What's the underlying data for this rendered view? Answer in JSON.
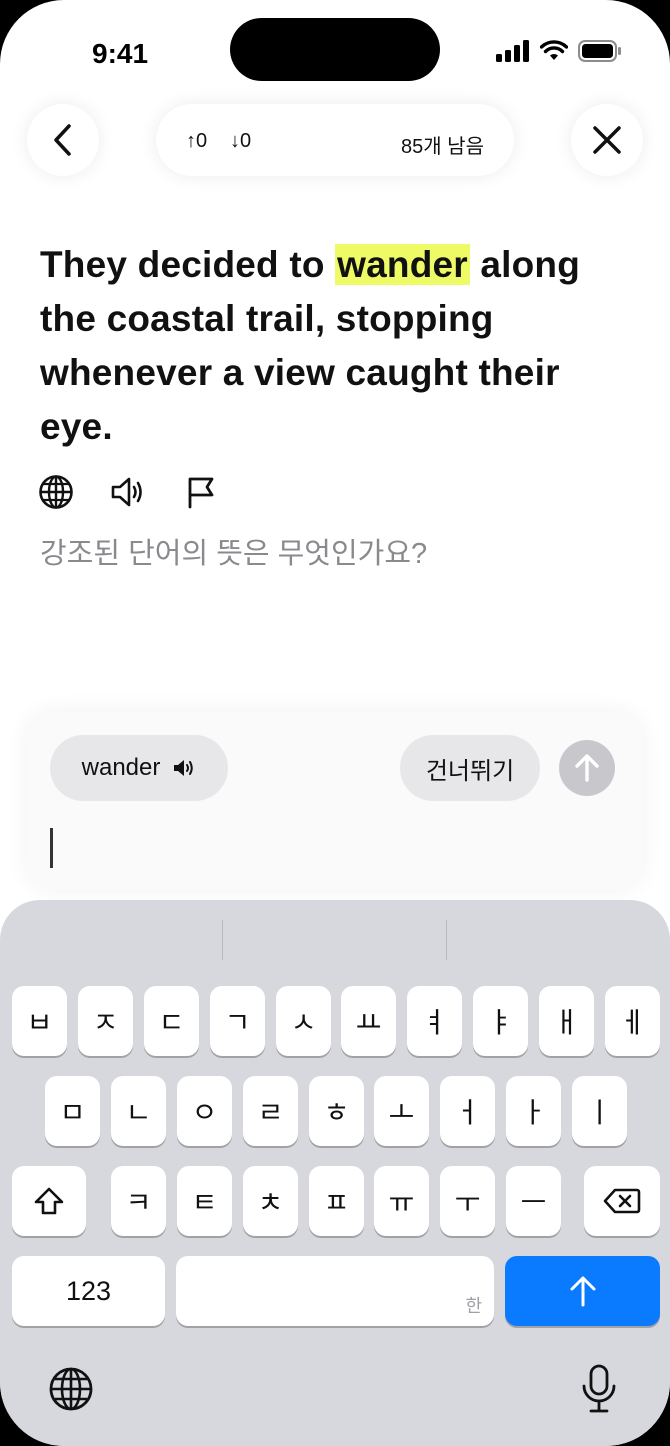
{
  "status": {
    "time": "9:41"
  },
  "topbar": {
    "up_count": "↑0",
    "down_count": "↓0",
    "remaining": "85개 남음"
  },
  "sentence": {
    "before": "They decided to ",
    "highlight": "wander",
    "after": " along the coastal trail, stopping whenever a view caught their eye."
  },
  "question": "강조된 단어의 뜻은 무엇인가요?",
  "answer": {
    "word_chip": "wander",
    "skip_label": "건너뛰기",
    "input_value": ""
  },
  "keyboard": {
    "row1": [
      "ㅂ",
      "ㅈ",
      "ㄷ",
      "ㄱ",
      "ㅅ",
      "ㅛ",
      "ㅕ",
      "ㅑ",
      "ㅐ",
      "ㅔ"
    ],
    "row2": [
      "ㅁ",
      "ㄴ",
      "ㅇ",
      "ㄹ",
      "ㅎ",
      "ㅗ",
      "ㅓ",
      "ㅏ",
      "ㅣ"
    ],
    "row3": [
      "ㅋ",
      "ㅌ",
      "ㅊ",
      "ㅍ",
      "ㅠ",
      "ㅜ",
      "ㅡ"
    ],
    "numbers_label": "123",
    "space_hint": "한"
  },
  "colors": {
    "highlight": "#eefb67",
    "return_key": "#0a7bff"
  }
}
